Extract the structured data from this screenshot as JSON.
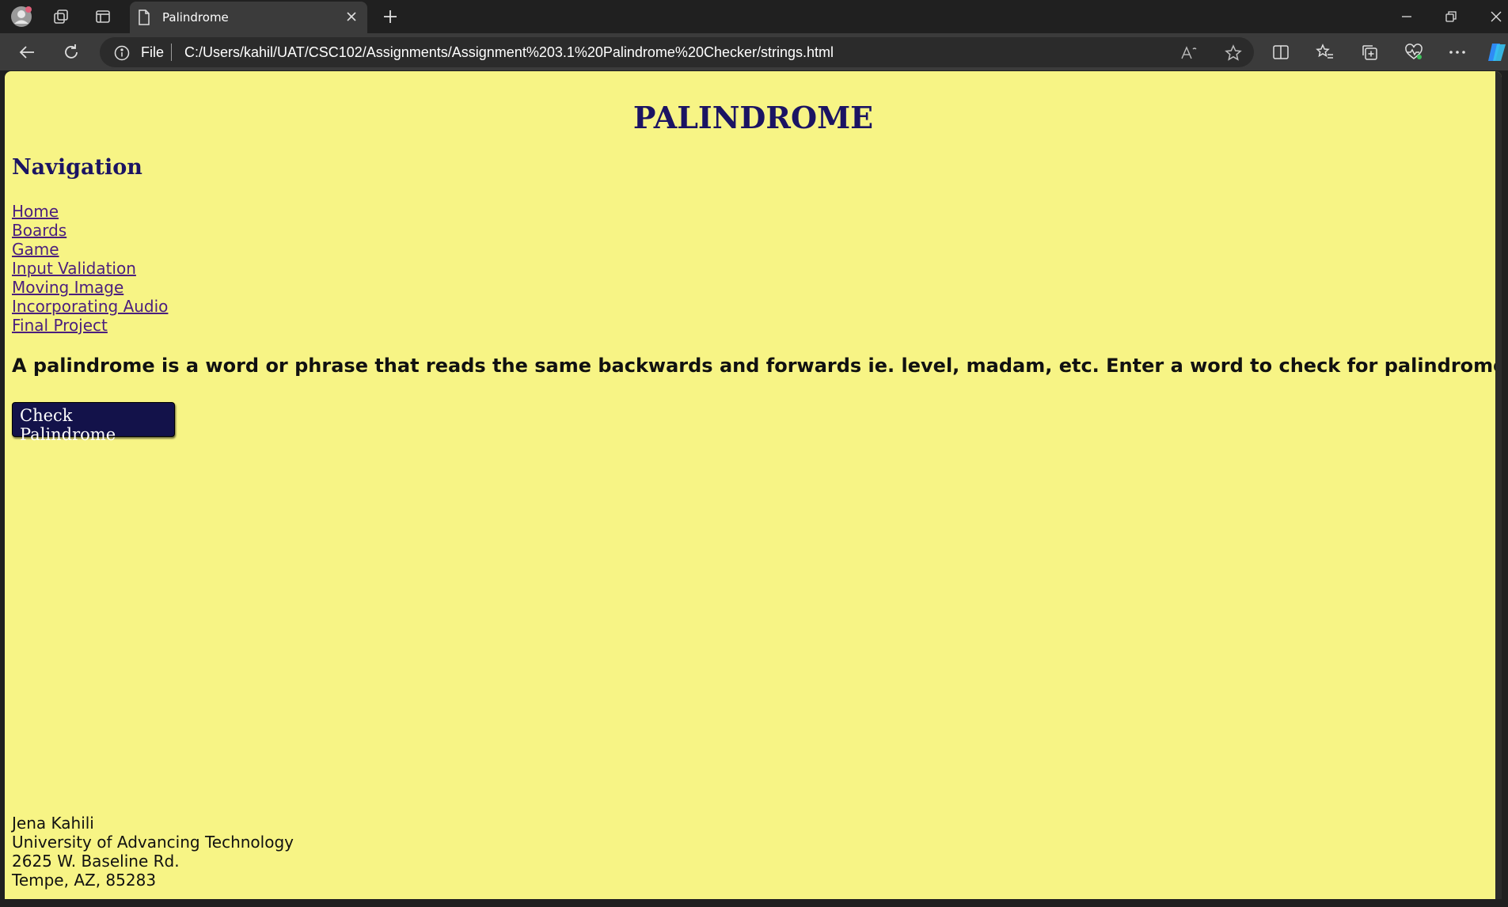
{
  "browser": {
    "tab": {
      "title": "Palindrome"
    },
    "address": {
      "scheme_label": "File",
      "url": "C:/Users/kahil/UAT/CSC102/Assignments/Assignment%203.1%20Palindrome%20Checker/strings.html"
    },
    "icons": {
      "profile": "profile-avatar-icon",
      "workspaces": "workspaces-icon",
      "tab_actions": "vertical-tabs-icon",
      "tab_doc": "document-icon",
      "tab_close": "close-icon",
      "new_tab": "plus-icon",
      "minimize": "minimize-icon",
      "restore": "restore-icon",
      "close_window": "close-icon",
      "back": "back-arrow-icon",
      "refresh": "refresh-icon",
      "info": "info-icon",
      "read_aloud": "read-aloud-icon",
      "favorite": "star-icon",
      "split_screen": "split-screen-icon",
      "favorites": "favorites-list-icon",
      "collections": "collections-icon",
      "browser_essentials": "heart-pulse-icon",
      "more": "more-icon",
      "copilot": "copilot-icon"
    }
  },
  "page": {
    "title": "PALINDROME",
    "nav_heading": "Navigation",
    "nav_links": [
      "Home",
      "Boards",
      "Game",
      "Input Validation",
      "Moving Image",
      "Incorporating Audio",
      "Final Project"
    ],
    "description": "A palindrome is a word or phrase that reads the same backwards and forwards ie. level, madam, etc. Enter a word to check for palindrome.",
    "button_label": "Check Palindrome",
    "footer": [
      "Jena Kahili",
      "University of Advancing Technology",
      "2625 W. Baseline Rd.",
      "Tempe, AZ, 85283"
    ]
  },
  "colors": {
    "page_background": "#f7f485",
    "heading": "#1b1463",
    "link": "#4b1f7e",
    "button_background": "#13124a",
    "browser_chrome": "#202020",
    "toolbar": "#3b3b3b"
  }
}
